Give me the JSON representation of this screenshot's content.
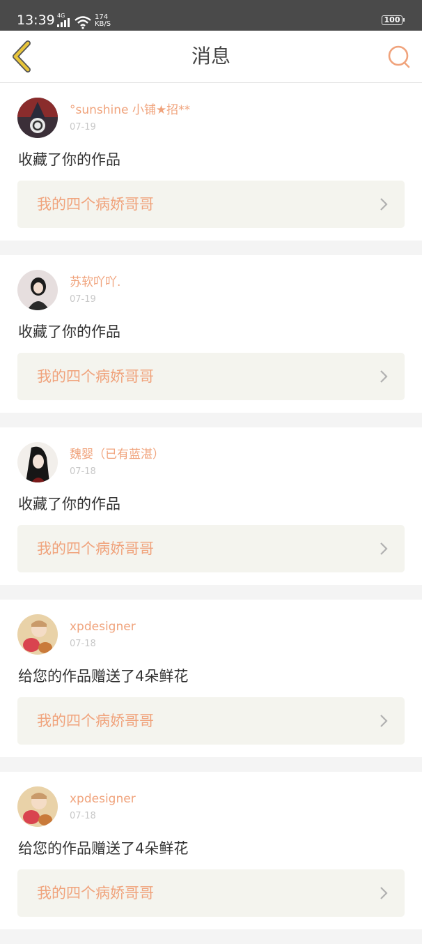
{
  "status_bar": {
    "time": "13:39",
    "network": "4G",
    "speed_value": "174",
    "speed_unit": "KB/S",
    "battery": "100"
  },
  "header": {
    "title": "消息",
    "back_icon": "chevron-left-icon",
    "search_icon": "search-icon",
    "accent": "#f0a37c",
    "back_color": "#e8c53a"
  },
  "messages": [
    {
      "name": "°sunshine 小铺★招**",
      "date": "07-19",
      "text": "收藏了你的作品",
      "work": "我的四个病娇哥哥"
    },
    {
      "name": "苏软吖吖.",
      "date": "07-19",
      "text": "收藏了你的作品",
      "work": "我的四个病娇哥哥"
    },
    {
      "name": "魏婴（已有蓝湛）",
      "date": "07-18",
      "text": "收藏了你的作品",
      "work": "我的四个病娇哥哥"
    },
    {
      "name": "xpdesigner",
      "date": "07-18",
      "text": "给您的作品赠送了4朵鲜花",
      "work": "我的四个病娇哥哥"
    },
    {
      "name": "xpdesigner",
      "date": "07-18",
      "text": "给您的作品赠送了4朵鲜花",
      "work": "我的四个病娇哥哥"
    }
  ]
}
